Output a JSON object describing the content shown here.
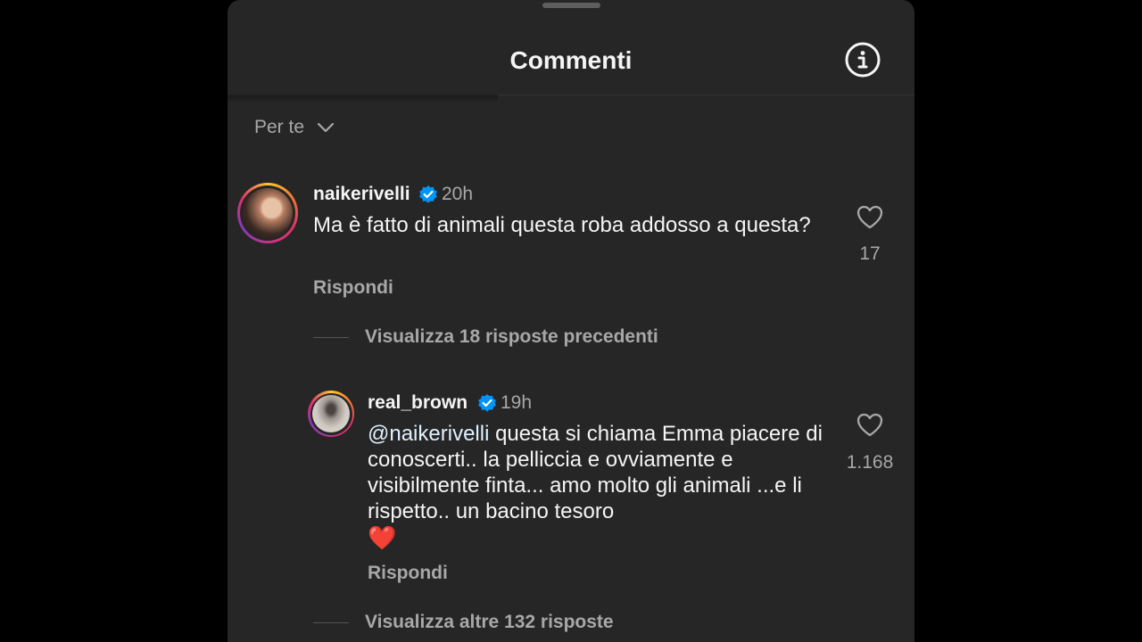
{
  "header": {
    "title": "Commenti",
    "info_icon": "info-circle-icon"
  },
  "sort": {
    "label": "Per te",
    "icon": "chevron-down-icon"
  },
  "comments": [
    {
      "username": "naikerivelli",
      "verified": true,
      "time": "20h",
      "text": "Ma è fatto di animali questa roba addosso a questa?",
      "likes": "17",
      "reply_label": "Rispondi",
      "view_replies": "Visualizza 18 risposte precedenti"
    }
  ],
  "replies": [
    {
      "username": "real_brown",
      "verified": true,
      "time": "19h",
      "mention": "@naikerivelli",
      "text": " questa si chiama Emma piacere di conoscerti.. la pelliccia e ovviamente e visibilmente finta... amo molto gli animali ...e li rispetto.. un bacino tesoro",
      "emoji": "❤️",
      "likes": "1.168",
      "reply_label": "Rispondi"
    }
  ],
  "more_replies": "Visualizza altre 132 risposte",
  "colors": {
    "background": "#262626",
    "text_primary": "#f5f5f5",
    "text_secondary": "#a8a8a8",
    "verified_blue": "#0095f6"
  }
}
